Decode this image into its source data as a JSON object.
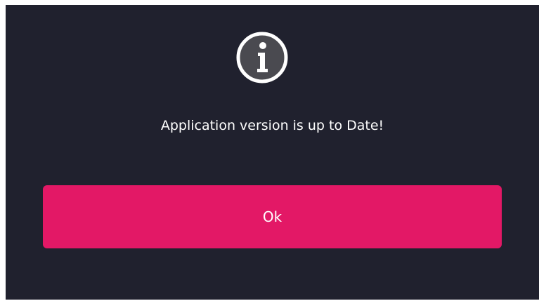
{
  "dialog": {
    "icon": "info-icon",
    "message": "Application version is up to Date!",
    "ok_label": "Ok"
  },
  "colors": {
    "background": "#20212e",
    "accent": "#e31866",
    "icon_circle": "#4a4a50",
    "text": "#ffffff"
  }
}
